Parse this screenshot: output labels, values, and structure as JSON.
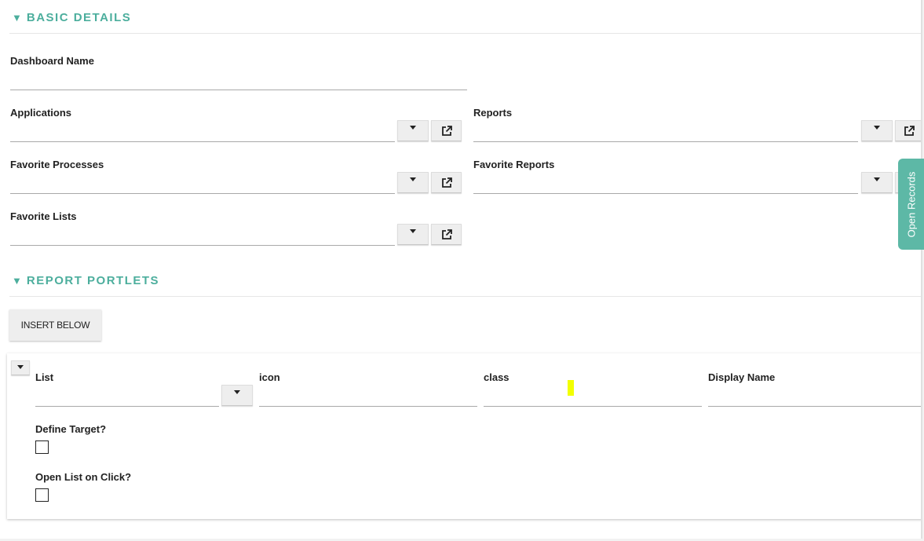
{
  "basic_details": {
    "title": "BASIC DETAILS",
    "dashboard_name_label": "Dashboard Name",
    "applications_label": "Applications",
    "reports_label": "Reports",
    "favorite_processes_label": "Favorite Processes",
    "favorite_reports_label": "Favorite Reports",
    "favorite_lists_label": "Favorite Lists"
  },
  "report_portlets": {
    "title": "REPORT PORTLETS",
    "insert_below_label": "INSERT BELOW",
    "list_label": "List",
    "icon_label": "icon",
    "class_label": "class",
    "display_name_label": "Display Name",
    "define_target_label": "Define Target?",
    "open_list_on_click_label": "Open List on Click?"
  },
  "side_tab": {
    "label": "Open Records"
  },
  "colors": {
    "accent": "#4cae9d",
    "side_tab": "#5db8a6",
    "highlight": "#f2ff00"
  }
}
